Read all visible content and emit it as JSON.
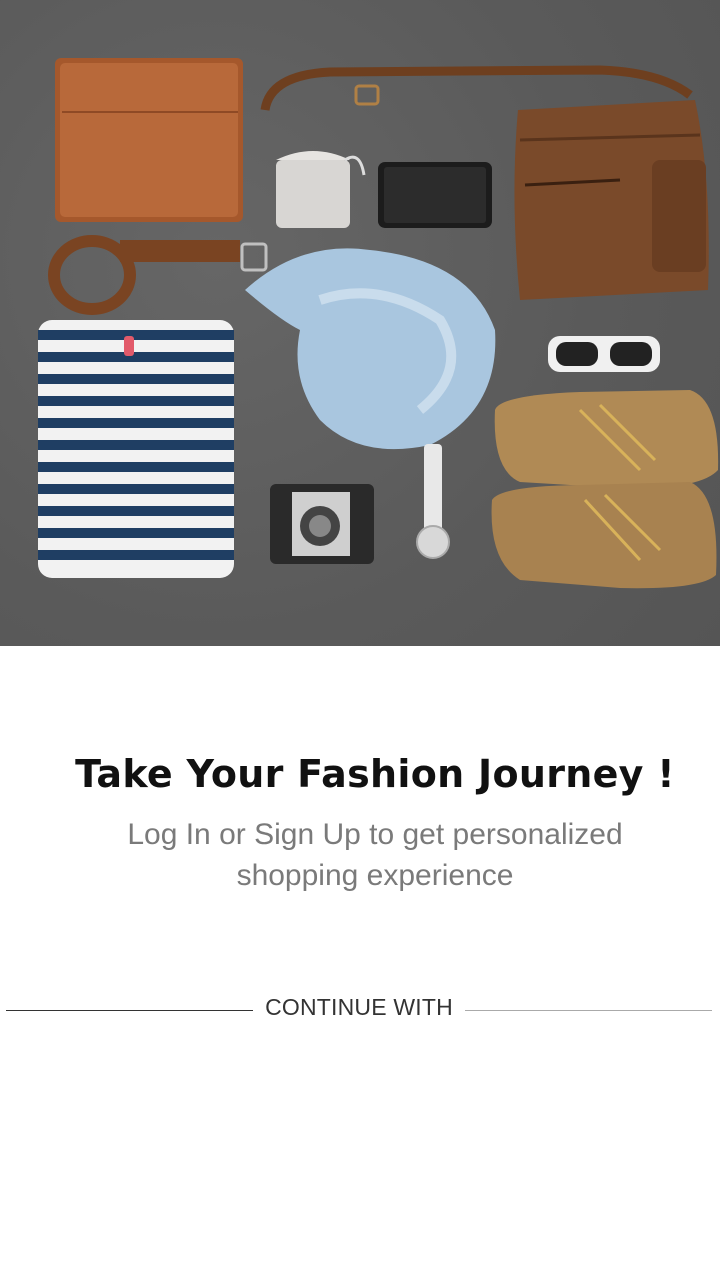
{
  "hero": {
    "image_alt": "fashion flat-lay photo"
  },
  "intro": {
    "title": "Take Your Fashion Journey !",
    "subtitle_line1": "Log In or Sign Up to get personalized",
    "subtitle_line2": "shopping experience"
  },
  "divider": {
    "label": "CONTINUE WITH"
  },
  "colors": {
    "hero_background": "#5c5c5c",
    "title": "#111111",
    "subtitle": "#7a7a7a"
  }
}
